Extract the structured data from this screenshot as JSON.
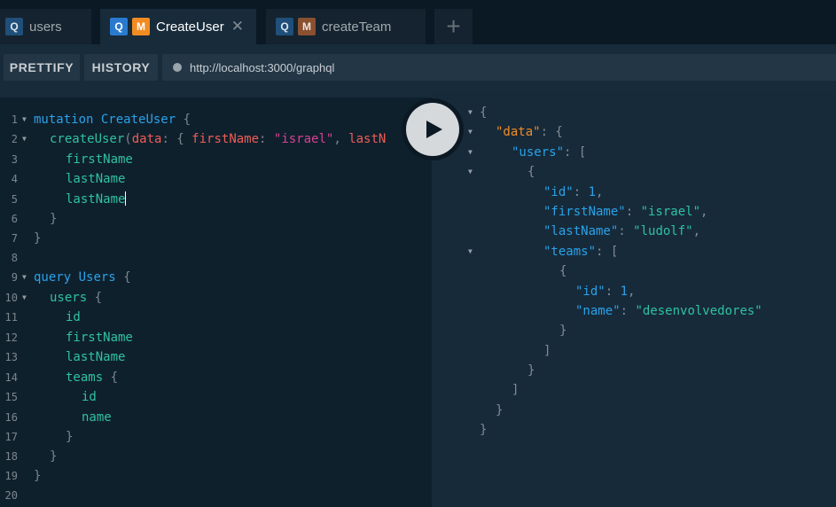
{
  "tabs": [
    {
      "label": "users",
      "badges": [
        "Q"
      ],
      "active": false
    },
    {
      "label": "CreateUser",
      "badges": [
        "Q",
        "M"
      ],
      "active": true,
      "close": "✕"
    },
    {
      "label": "createTeam",
      "badges": [
        "Q",
        "M"
      ],
      "active": false
    }
  ],
  "tab_add_label": "+",
  "toolbar": {
    "prettify_label": "PRETTIFY",
    "history_label": "HISTORY",
    "endpoint_url": "http://localhost:3000/graphql"
  },
  "editor": {
    "line_numbers": [
      "1",
      "2",
      "3",
      "4",
      "5",
      "6",
      "7",
      "8",
      "9",
      "10",
      "11",
      "12",
      "13",
      "14",
      "15",
      "16",
      "17",
      "18",
      "19",
      "20"
    ],
    "mutation_keyword": "mutation",
    "mutation_name": "CreateUser",
    "mutation_field": "createUser",
    "arg_data": "data",
    "arg_first_name": "firstName",
    "arg_first_name_value": "\"israel\"",
    "arg_last_name_truncated": "lastN",
    "mutation_fields": [
      "firstName",
      "lastName",
      "lastName"
    ],
    "query_keyword": "query",
    "query_name": "Users",
    "query_root_field": "users",
    "query_fields": [
      "id",
      "firstName",
      "lastName"
    ],
    "teams_field": "teams",
    "teams_subfields": [
      "id",
      "name"
    ]
  },
  "result": {
    "data_key": "\"data\"",
    "users_key": "\"users\"",
    "id_key": "\"id\"",
    "id_value": "1",
    "first_name_key": "\"firstName\"",
    "first_name_value": "\"israel\"",
    "last_name_key": "\"lastName\"",
    "last_name_value": "\"ludolf\"",
    "teams_key": "\"teams\"",
    "team_id_key": "\"id\"",
    "team_id_value": "1",
    "team_name_key": "\"name\"",
    "team_name_value": "\"desenvolvedores\""
  },
  "colors": {
    "keyword": "#2aa2e8",
    "field": "#2fc2a0",
    "argument": "#f25c54",
    "string": "#d64292",
    "result_key": "#f28c22",
    "mutation_badge": "#f28c22",
    "query_badge": "#2a7bd0"
  },
  "icons": {
    "play": "play-icon",
    "close": "close-icon",
    "add": "plus-icon",
    "fold": "fold-arrow-icon"
  }
}
